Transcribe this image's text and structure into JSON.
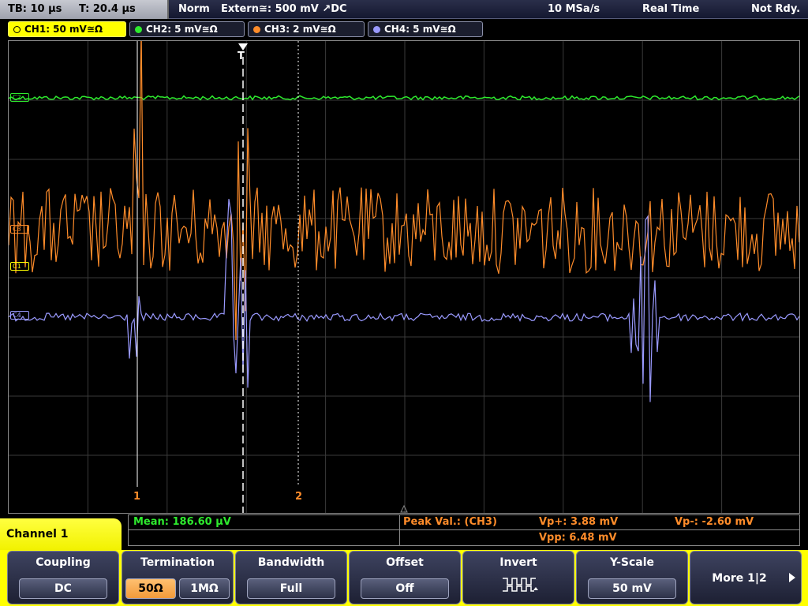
{
  "status": {
    "timebase": "TB: 10 µs",
    "trigger_pos": "T: 20.4 µs",
    "mode": "Norm",
    "trigger_source": "Extern≅: 500 mV ↗DC",
    "sample_rate": "10 MSa/s",
    "acq_mode": "Real Time",
    "ready": "Not Rdy."
  },
  "channels": [
    {
      "label": "CH1: 50 mV≅Ω",
      "color": "#ffff00",
      "active": true
    },
    {
      "label": "CH2: 5 mV≅Ω",
      "color": "#2eea2e",
      "active": false
    },
    {
      "label": "CH3: 2 mV≅Ω",
      "color": "#ff8c2a",
      "active": false
    },
    {
      "label": "CH4: 5 mV≅Ω",
      "color": "#9a9aff",
      "active": false
    }
  ],
  "screen": {
    "trigger_marker": "T",
    "cursor1_label": "1",
    "cursor2_label": "2",
    "ch_markers": [
      "C2",
      "C3",
      "C1",
      "C4"
    ]
  },
  "measurements": {
    "mean": "Mean: 186.60 µV",
    "peak_title": "Peak Val.:  (CH3)",
    "vp_plus": "Vp+: 3.88 mV",
    "vp_minus": "Vp-: -2.60 mV",
    "vpp": "Vpp: 6.48 mV"
  },
  "menu": {
    "title": "Channel 1",
    "softkeys": [
      {
        "label": "Coupling",
        "value": "DC"
      },
      {
        "label": "Termination",
        "options": [
          "50Ω",
          "1MΩ"
        ],
        "selected": 0
      },
      {
        "label": "Bandwidth",
        "value": "Full"
      },
      {
        "label": "Offset",
        "value": "Off"
      },
      {
        "label": "Invert",
        "icon": "invert-square-wave-icon"
      },
      {
        "label": "Y-Scale",
        "value": "50 mV"
      },
      {
        "label": "More 1|2",
        "icon": "arrow-right-icon"
      }
    ]
  }
}
